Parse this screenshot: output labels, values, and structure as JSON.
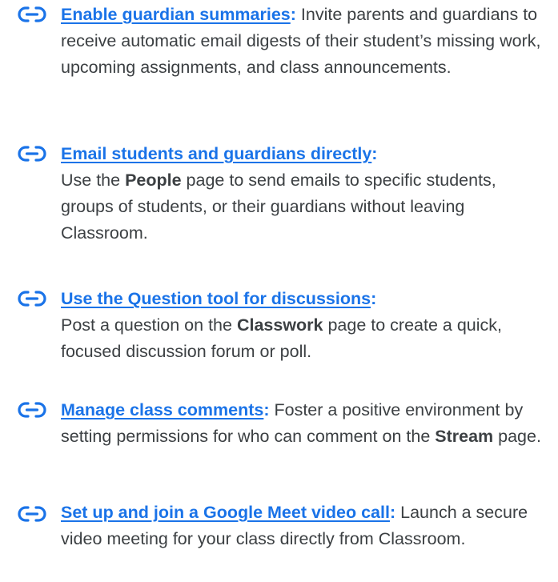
{
  "colors": {
    "link": "#1a73e8",
    "body_text": "#3c4043",
    "background": "#ffffff"
  },
  "items": [
    {
      "icon": "link-icon",
      "link_label": "Enable guardian summaries",
      "colon": ":",
      "text_1": " Invite parents and guardians to receive automatic email digests of their student’s missing work, upcoming assignments, and class announcements."
    },
    {
      "icon": "link-icon",
      "link_label": "Email students and guardians directly",
      "colon": ":",
      "text_1": " Use the ",
      "bold_1": "People",
      "text_2": " page to send emails to specific students, groups of students, or their guardians without leaving Classroom."
    },
    {
      "icon": "link-icon",
      "link_label": "Use the Question tool for discussions",
      "colon": ":",
      "text_1": " Post a question on the ",
      "bold_1": "Classwork",
      "text_2": " page to create a quick, focused discussion forum or poll."
    },
    {
      "icon": "link-icon",
      "link_label": "Manage class comments",
      "colon": ":",
      "text_1": " Foster a positive environment by setting permissions for who can comment on the ",
      "bold_1": "Stream",
      "text_2": " page."
    },
    {
      "icon": "link-icon",
      "link_label": "Set up and join a Google Meet video call",
      "colon": ":",
      "text_1": " Launch a secure video meeting for your class directly from Classroom."
    }
  ]
}
